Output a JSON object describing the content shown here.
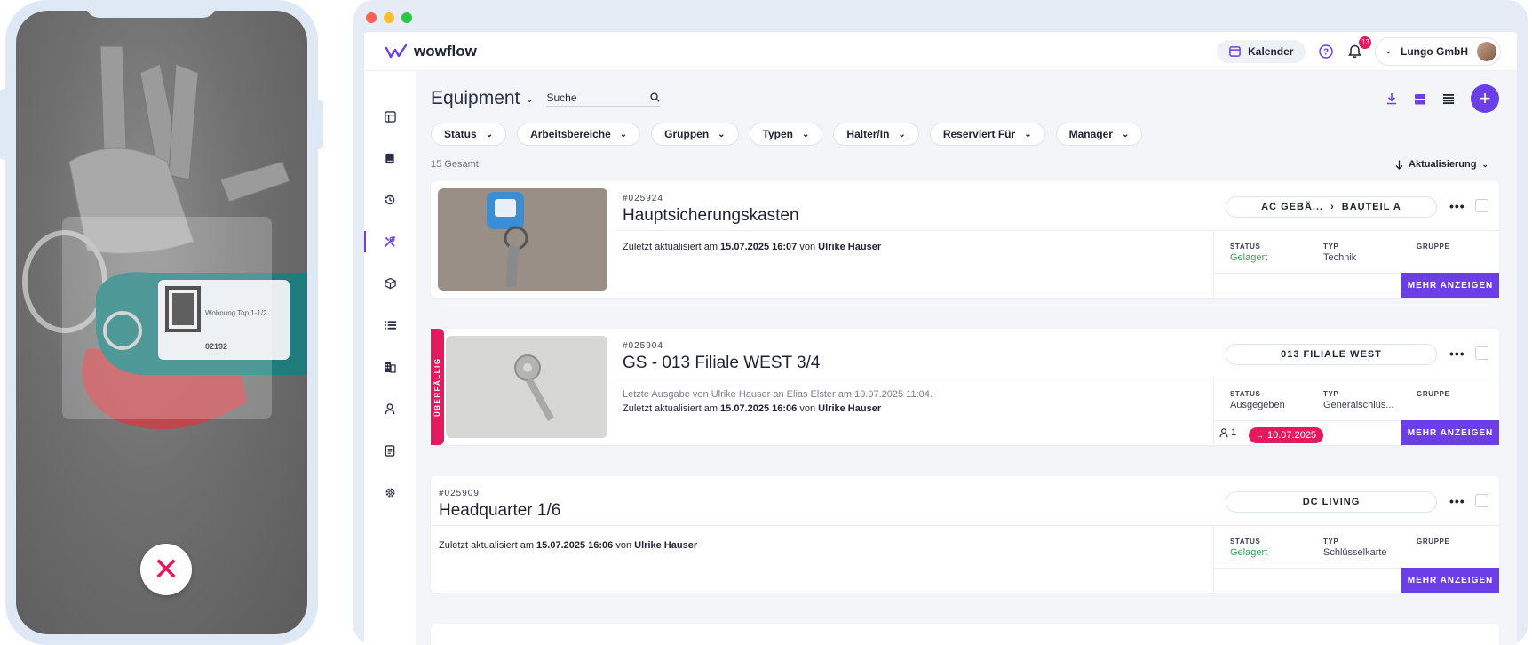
{
  "app": {
    "name": "wowflow"
  },
  "header": {
    "calendar_label": "Kalender",
    "notifications_count": "13",
    "account_name": "Lungo GmbH"
  },
  "page": {
    "title": "Equipment",
    "search_value": "Suche",
    "total": "15 Gesamt",
    "sort_label": "Aktualisierung"
  },
  "filters": [
    "Status",
    "Arbeitsbereiche",
    "Gruppen",
    "Typen",
    "Halter/In",
    "Reserviert Für",
    "Manager"
  ],
  "labels": {
    "status": "STATUS",
    "type": "TYP",
    "group": "GRUPPE",
    "more": "MEHR ANZEIGEN",
    "overdue": "ÜBERFÄLLIG"
  },
  "items": [
    {
      "id": "#025924",
      "title": "Hauptsicherungskasten",
      "location_a": "AC GEBÄ...",
      "location_b": "BAUTEIL A",
      "updated_prefix": "Zuletzt aktualisiert am",
      "updated_at": "15.07.2025 16:07",
      "updated_by_prefix": "von",
      "updated_by": "Ulrike Hauser",
      "status": "Gelagert",
      "type": "Technik"
    },
    {
      "id": "#025904",
      "title": "GS - 013 Filiale WEST 3/4",
      "location_a": "013 FILIALE WEST",
      "last_issue": "Letzte Ausgabe von Ulrike Hauser an Elias Elster am 10.07.2025 11:04.",
      "updated_prefix": "Zuletzt aktualisiert am",
      "updated_at": "15.07.2025 16:06",
      "updated_by_prefix": "von",
      "updated_by": "Ulrike Hauser",
      "status": "Ausgegeben",
      "type": "Generalschlüs...",
      "holders": "1",
      "due_date": "10.07.2025"
    },
    {
      "id": "#025909",
      "title": "Headquarter 1/6",
      "location_a": "DC LIVING",
      "updated_prefix": "Zuletzt aktualisiert am",
      "updated_at": "15.07.2025 16:06",
      "updated_by_prefix": "von",
      "updated_by": "Ulrike Hauser",
      "status": "Gelagert",
      "type": "Schlüsselkarte"
    }
  ],
  "phone": {
    "scanned_tag_text": "Wohnung Top 1-1/2",
    "scanned_tag_number": "02192"
  },
  "colors": {
    "brand": "#6c3fe6",
    "overdue": "#e5195e",
    "stored": "#34a05a"
  }
}
